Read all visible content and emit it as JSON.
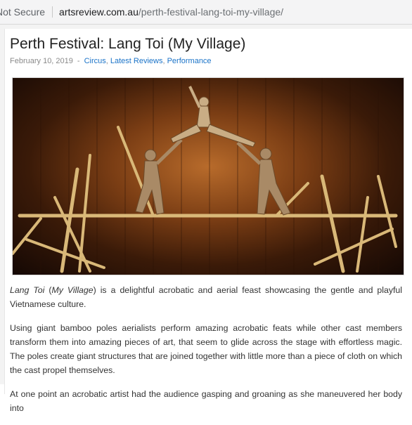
{
  "browser": {
    "security_label": "Not Secure",
    "url_domain": "artsreview.com.au",
    "url_path": "/perth-festival-lang-toi-my-village/"
  },
  "article": {
    "title": "Perth Festival: Lang Toi (My Village)",
    "date": "February 10, 2019",
    "date_separator": "-",
    "categories": [
      "Circus",
      "Latest Reviews",
      "Performance"
    ],
    "category_separator": ",",
    "image_alt": "Acrobats performing on bamboo poles",
    "paragraphs": {
      "p1": {
        "em1": "Lang Toi",
        "t1": " (",
        "em2": "My Village",
        "t2": ") is a delightful acrobatic and aerial feast showcasing the gentle and playful Vietnamese culture."
      },
      "p2": "Using giant bamboo poles aerialists perform amazing acrobatic feats while other cast members transform them into amazing pieces of art, that seem to glide across the stage with effortless magic. The poles create giant structures that are joined together with little more than a piece of cloth on which the cast propel themselves.",
      "p3": "At one point an acrobatic artist had the audience gasping and groaning as she maneuvered her body into"
    }
  },
  "colors": {
    "link": "#1a73c8",
    "title": "#222222",
    "stage_warm": "#b86b2b"
  }
}
